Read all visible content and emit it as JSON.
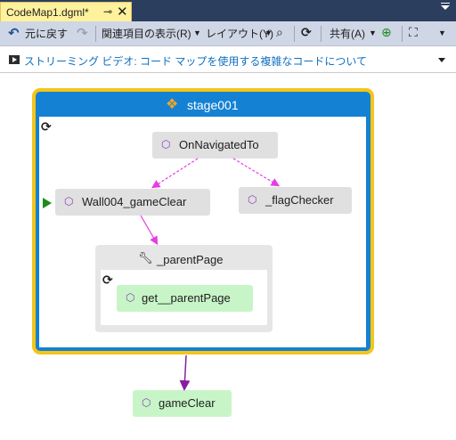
{
  "tab": {
    "title": "CodeMap1.dgml*",
    "pin": "⊸",
    "close": "✕"
  },
  "toolbar": {
    "undo_label": "元に戻す",
    "related_items": "関連項目の表示(R)",
    "layout": "レイアウト(Y)",
    "share": "共有(A)"
  },
  "infobar": {
    "link": "ストリーミング ビデオ: コード マップを使用する複雑なコードについて"
  },
  "graph": {
    "group_title": "stage001",
    "nodes": {
      "on_navigated": "OnNavigatedTo",
      "wall": "Wall004_gameClear",
      "flag_checker": "_flagChecker",
      "parent_page_group": "_parentPage",
      "get_parent_page": "get__parentPage",
      "game_clear": "gameClear"
    }
  },
  "icons": {
    "undo": "undo-icon",
    "redo": "redo-icon",
    "class": "class-icon",
    "method": "cube-icon",
    "property": "wrench-icon",
    "refresh": "refresh-icon"
  },
  "colors": {
    "accent_blue": "#1581d3",
    "selection_yellow": "#f5c518",
    "call_magenta": "#e63ce6",
    "call_purple": "#8a1d9e",
    "green_node": "#c8f5c8"
  }
}
